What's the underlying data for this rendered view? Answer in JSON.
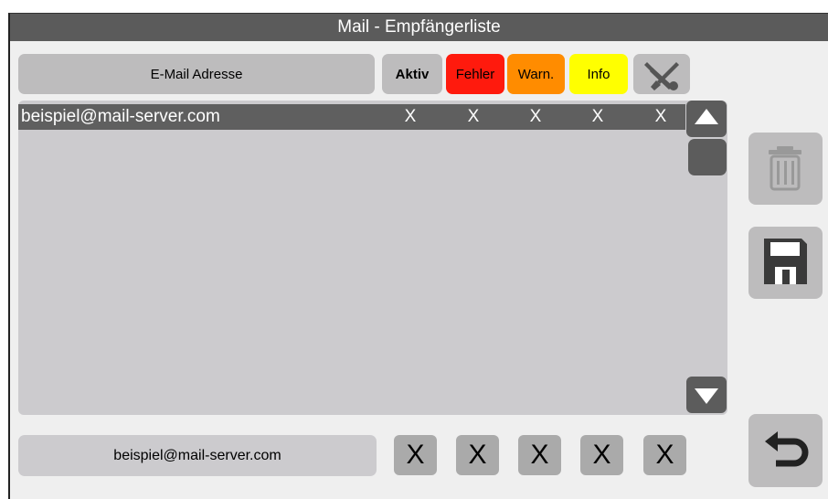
{
  "window": {
    "title": "Mail - Empfängerliste"
  },
  "header": {
    "email_label": "E-Mail Adresse",
    "aktiv_label": "Aktiv",
    "fehler_label": "Fehler",
    "warn_label": "Warn.",
    "info_label": "Info",
    "tools_icon": "tools-icon"
  },
  "list": {
    "rows": [
      {
        "email": "beispiel@mail-server.com",
        "aktiv": "X",
        "fehler": "X",
        "warn": "X",
        "info": "X",
        "tools": "X"
      }
    ]
  },
  "side_buttons": {
    "delete_icon": "trash-icon",
    "save_icon": "floppy-disk-icon",
    "back_icon": "back-arrow-icon"
  },
  "editor": {
    "email_value": "beispiel@mail-server.com",
    "toggles": [
      "X",
      "X",
      "X",
      "X",
      "X"
    ]
  },
  "colors": {
    "fehler": "#ff1a0d",
    "warn": "#ff8c00",
    "info": "#ffff00",
    "selection": "#5f5f5f"
  }
}
